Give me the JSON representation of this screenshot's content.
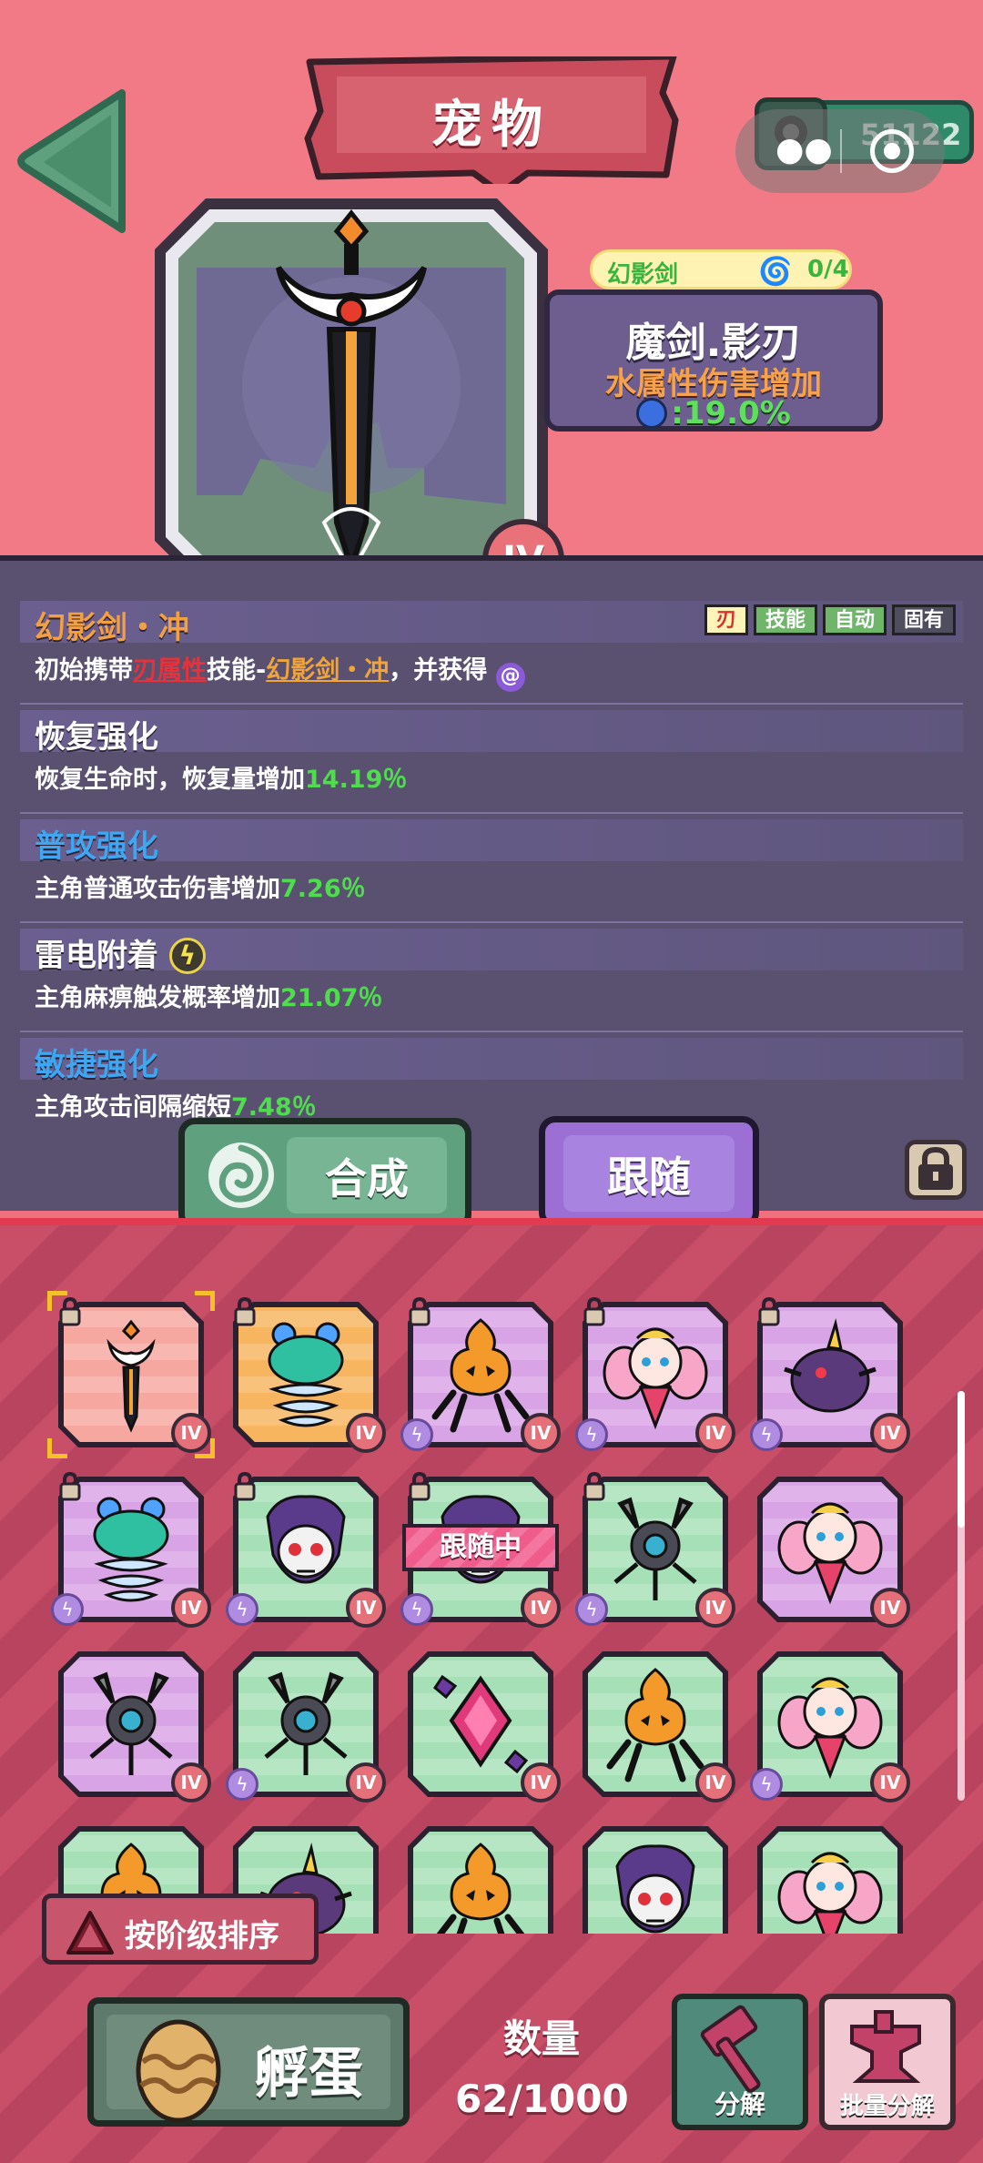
{
  "header": {
    "title": "宠物",
    "currency_value": "51122"
  },
  "selected_pet": {
    "collection_name": "幻影剑",
    "collection_progress": "0/4",
    "name": "魔剑.影刃",
    "bonus_label": "水属性伤害增加",
    "bonus_value": ":19.0%",
    "tier": "IV"
  },
  "skills": [
    {
      "name": "幻影剑・冲",
      "name_color": "#f3a043",
      "desc_parts": [
        "初始携带",
        "刃属性",
        "技能-",
        "幻影剑・冲",
        "，并获得"
      ],
      "tags": [
        "刃",
        "技能",
        "自动",
        "固有"
      ]
    },
    {
      "name": "恢复强化",
      "name_color": "#ffffff",
      "desc": "恢复生命时，恢复量增加",
      "value": "14.19％"
    },
    {
      "name": "普攻强化",
      "name_color": "#3fa6f2",
      "desc": "主角普通攻击伤害增加",
      "value": "7.26％"
    },
    {
      "name": "雷电附着",
      "name_color": "#ffffff",
      "desc": "主角麻痹触发概率增加",
      "value": "21.07％"
    },
    {
      "name": "敏捷强化",
      "name_color": "#3fa6f2",
      "desc": "主角攻击间隔缩短",
      "value": "7.48％"
    }
  ],
  "actions": {
    "compose_label": "合成",
    "follow_label": "跟随"
  },
  "inventory": {
    "following_label": "跟随中",
    "tier_label": "IV",
    "items": [
      {
        "kind": "sword",
        "bg": "#f6a8a0",
        "locked": true,
        "selected": true,
        "rune": false
      },
      {
        "kind": "spring",
        "bg": "#f7b560",
        "locked": true,
        "rune": false
      },
      {
        "kind": "pumpkin",
        "bg": "#d9a4e6",
        "locked": true,
        "rune": true
      },
      {
        "kind": "fairy",
        "bg": "#d9a4e6",
        "locked": true,
        "rune": true
      },
      {
        "kind": "blob",
        "bg": "#d9a4e6",
        "locked": true,
        "rune": true
      },
      {
        "kind": "spring",
        "bg": "#d9a4e6",
        "locked": true,
        "rune": true
      },
      {
        "kind": "skull",
        "bg": "#a6e0b6",
        "locked": true,
        "rune": true
      },
      {
        "kind": "skull",
        "bg": "#a6e0b6",
        "locked": true,
        "rune": true,
        "following": true
      },
      {
        "kind": "drone",
        "bg": "#a6e0b6",
        "locked": true,
        "rune": true
      },
      {
        "kind": "fairy",
        "bg": "#d9a4e6",
        "locked": false,
        "rune": false
      },
      {
        "kind": "drone",
        "bg": "#d9a4e6",
        "locked": false,
        "rune": false
      },
      {
        "kind": "drone",
        "bg": "#a6e0b6",
        "locked": false,
        "rune": true
      },
      {
        "kind": "gem",
        "bg": "#a6e0b6",
        "locked": false,
        "rune": false
      },
      {
        "kind": "pumpkin",
        "bg": "#a6e0b6",
        "locked": false,
        "rune": false
      },
      {
        "kind": "fairy",
        "bg": "#a6e0b6",
        "locked": false,
        "rune": true
      },
      {
        "kind": "pumpkin",
        "bg": "#a6e0b6",
        "locked": false,
        "rune": false
      },
      {
        "kind": "blob",
        "bg": "#a6e0b6",
        "locked": false,
        "rune": false
      },
      {
        "kind": "pumpkin",
        "bg": "#a6e0b6",
        "locked": false,
        "rune": false
      },
      {
        "kind": "skull",
        "bg": "#a6e0b6",
        "locked": false,
        "rune": false
      },
      {
        "kind": "fairy",
        "bg": "#a6e0b6",
        "locked": false,
        "rune": false
      }
    ],
    "scroll_position": 0.0
  },
  "bottom": {
    "sort_label": "按阶级排序",
    "hatch_label": "孵蛋",
    "count_label": "数量",
    "count_value": "62/1000",
    "decompose_label": "分解",
    "batch_decompose_label": "批量分解"
  },
  "icons": {
    "back": "back-arrow-icon",
    "currency": "gem-coin-icon",
    "menu": "more-dots-icon",
    "close": "target-close-icon",
    "water": "water-drop-icon",
    "lightning": "lightning-icon",
    "compose": "spiral-icon",
    "lock": "lock-icon",
    "egg": "egg-icon",
    "hammer": "hammer-icon",
    "anvil": "anvil-icon"
  }
}
